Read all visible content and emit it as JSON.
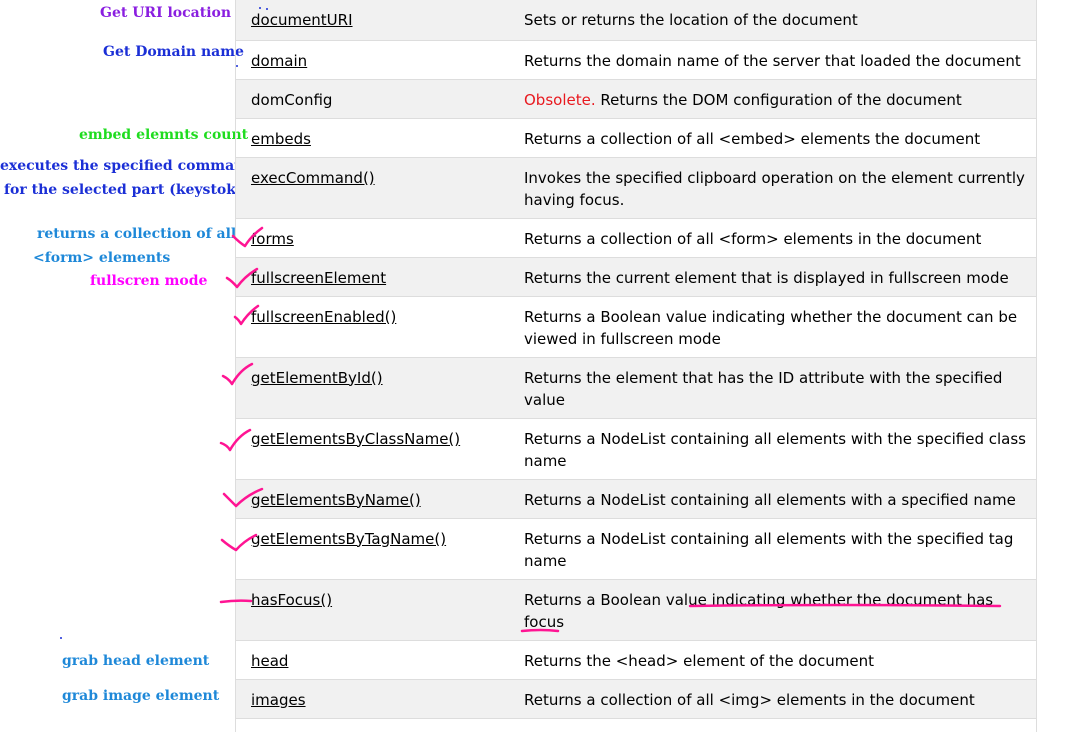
{
  "rows": [
    {
      "name": "documentURI",
      "desc": "Sets or returns the location of the document"
    },
    {
      "name": "domain",
      "desc": "Returns the domain name of the server that loaded the document"
    },
    {
      "name": "domConfig",
      "desc_prefix": "Obsolete.",
      "desc": " Returns the DOM configuration of the document"
    },
    {
      "name": "embeds",
      "desc": "Returns a collection of all <embed> elements the document"
    },
    {
      "name": "execCommand()",
      "desc": "Invokes the specified clipboard operation on the element currently having focus."
    },
    {
      "name": "forms",
      "desc": "Returns a collection of all <form> elements in the document"
    },
    {
      "name": "fullscreenElement",
      "desc": "Returns the current element that is displayed in fullscreen mode"
    },
    {
      "name": "fullscreenEnabled()",
      "desc": "Returns a Boolean value indicating whether the document can be viewed in fullscreen mode"
    },
    {
      "name": "getElementById()",
      "desc": "Returns the element that has the ID attribute with the specified value"
    },
    {
      "name": "getElementsByClassName()",
      "desc": "Returns a NodeList containing all elements with the specified class name"
    },
    {
      "name": "getElementsByName()",
      "desc": "Returns a NodeList containing all elements with a specified name"
    },
    {
      "name": "getElementsByTagName()",
      "desc": "Returns a NodeList containing all elements with the specified tag name"
    },
    {
      "name": "hasFocus()",
      "desc": "Returns a Boolean value indicating whether the document has focus"
    },
    {
      "name": "head",
      "desc": "Returns the <head> element of the document"
    },
    {
      "name": "images",
      "desc": "Returns a collection of all <img> elements in the document"
    }
  ],
  "notes": {
    "uri_get": "Get",
    "uri_rest": "URI location",
    "domain": "Get Domain name",
    "embeds": "embed elemnts count",
    "exec_line1": "executes the specified command",
    "exec_line2": "for the selected part (keystok)",
    "forms_line1": "returns a collection of all",
    "forms_line2": "<form> elements",
    "fullscreen": "fullscren mode",
    "head_grab": "grab",
    "head_rest": "head element",
    "images_grab": "grab",
    "images_rest": "image element"
  },
  "colors": {
    "note_purple": "#8a1ee0",
    "note_blue": "#1b2fd6",
    "note_green": "#1fdc1f",
    "note_lightblue": "#1e88d8",
    "note_magenta": "#ff00ff",
    "ink": "#ff1493",
    "obsolete": "#e8191f"
  }
}
